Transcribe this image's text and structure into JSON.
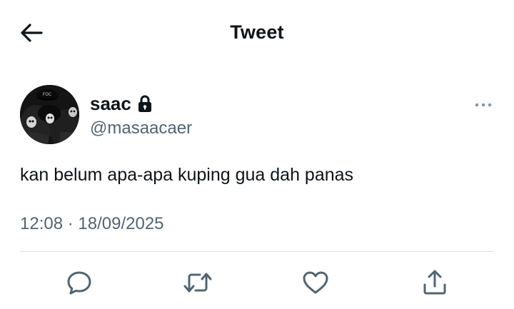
{
  "header": {
    "title": "Tweet",
    "back_icon": "arrow-left-icon"
  },
  "author": {
    "display_name": "saac",
    "handle": "@masaacaer",
    "protected_icon": "lock-icon",
    "avatar_cap_text": "FOC"
  },
  "tweet": {
    "text": "kan belum apa-apa kuping gua dah panas",
    "time": "12:08",
    "separator": "·",
    "date": "18/09/2025"
  },
  "actions": {
    "reply_icon": "reply-icon",
    "retweet_icon": "retweet-icon",
    "like_icon": "heart-icon",
    "share_icon": "share-icon"
  },
  "colors": {
    "text": "#0f1419",
    "secondary": "#536471",
    "divider": "#dfe3e6",
    "more": "#8b98a5"
  }
}
